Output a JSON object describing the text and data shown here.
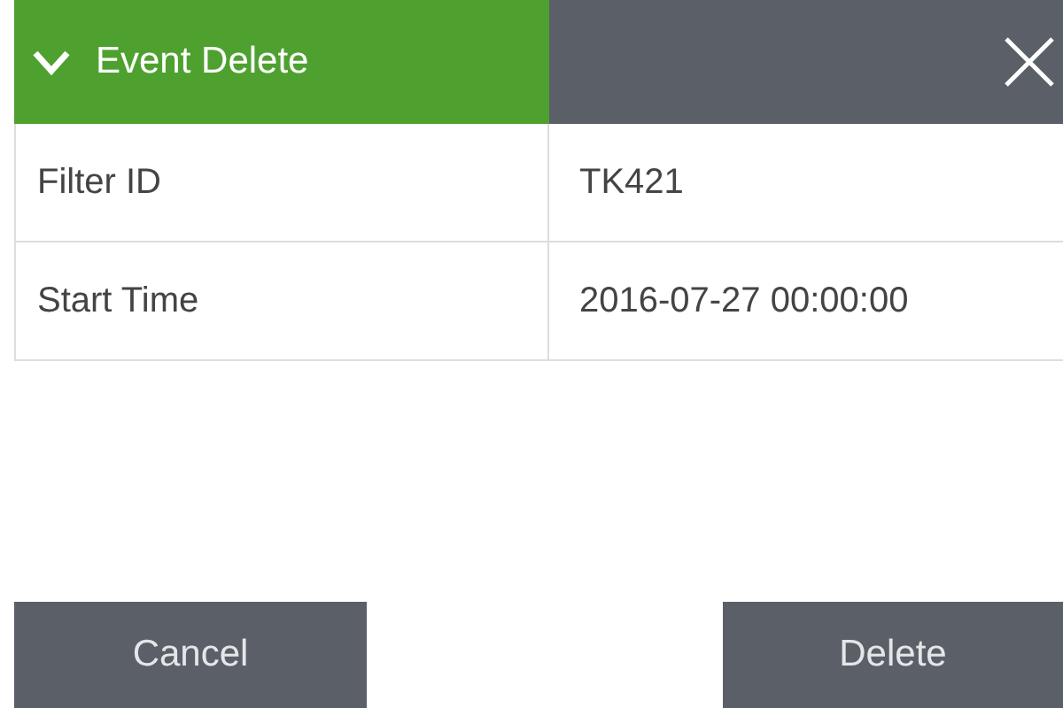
{
  "header": {
    "title": "Event Delete",
    "expanded": true
  },
  "fields": [
    {
      "label": "Filter ID",
      "value": "TK421"
    },
    {
      "label": "Start Time",
      "value": "2016-07-27 00:00:00"
    }
  ],
  "buttons": [
    {
      "label": "Cancel"
    },
    {
      "label": "Delete"
    }
  ]
}
